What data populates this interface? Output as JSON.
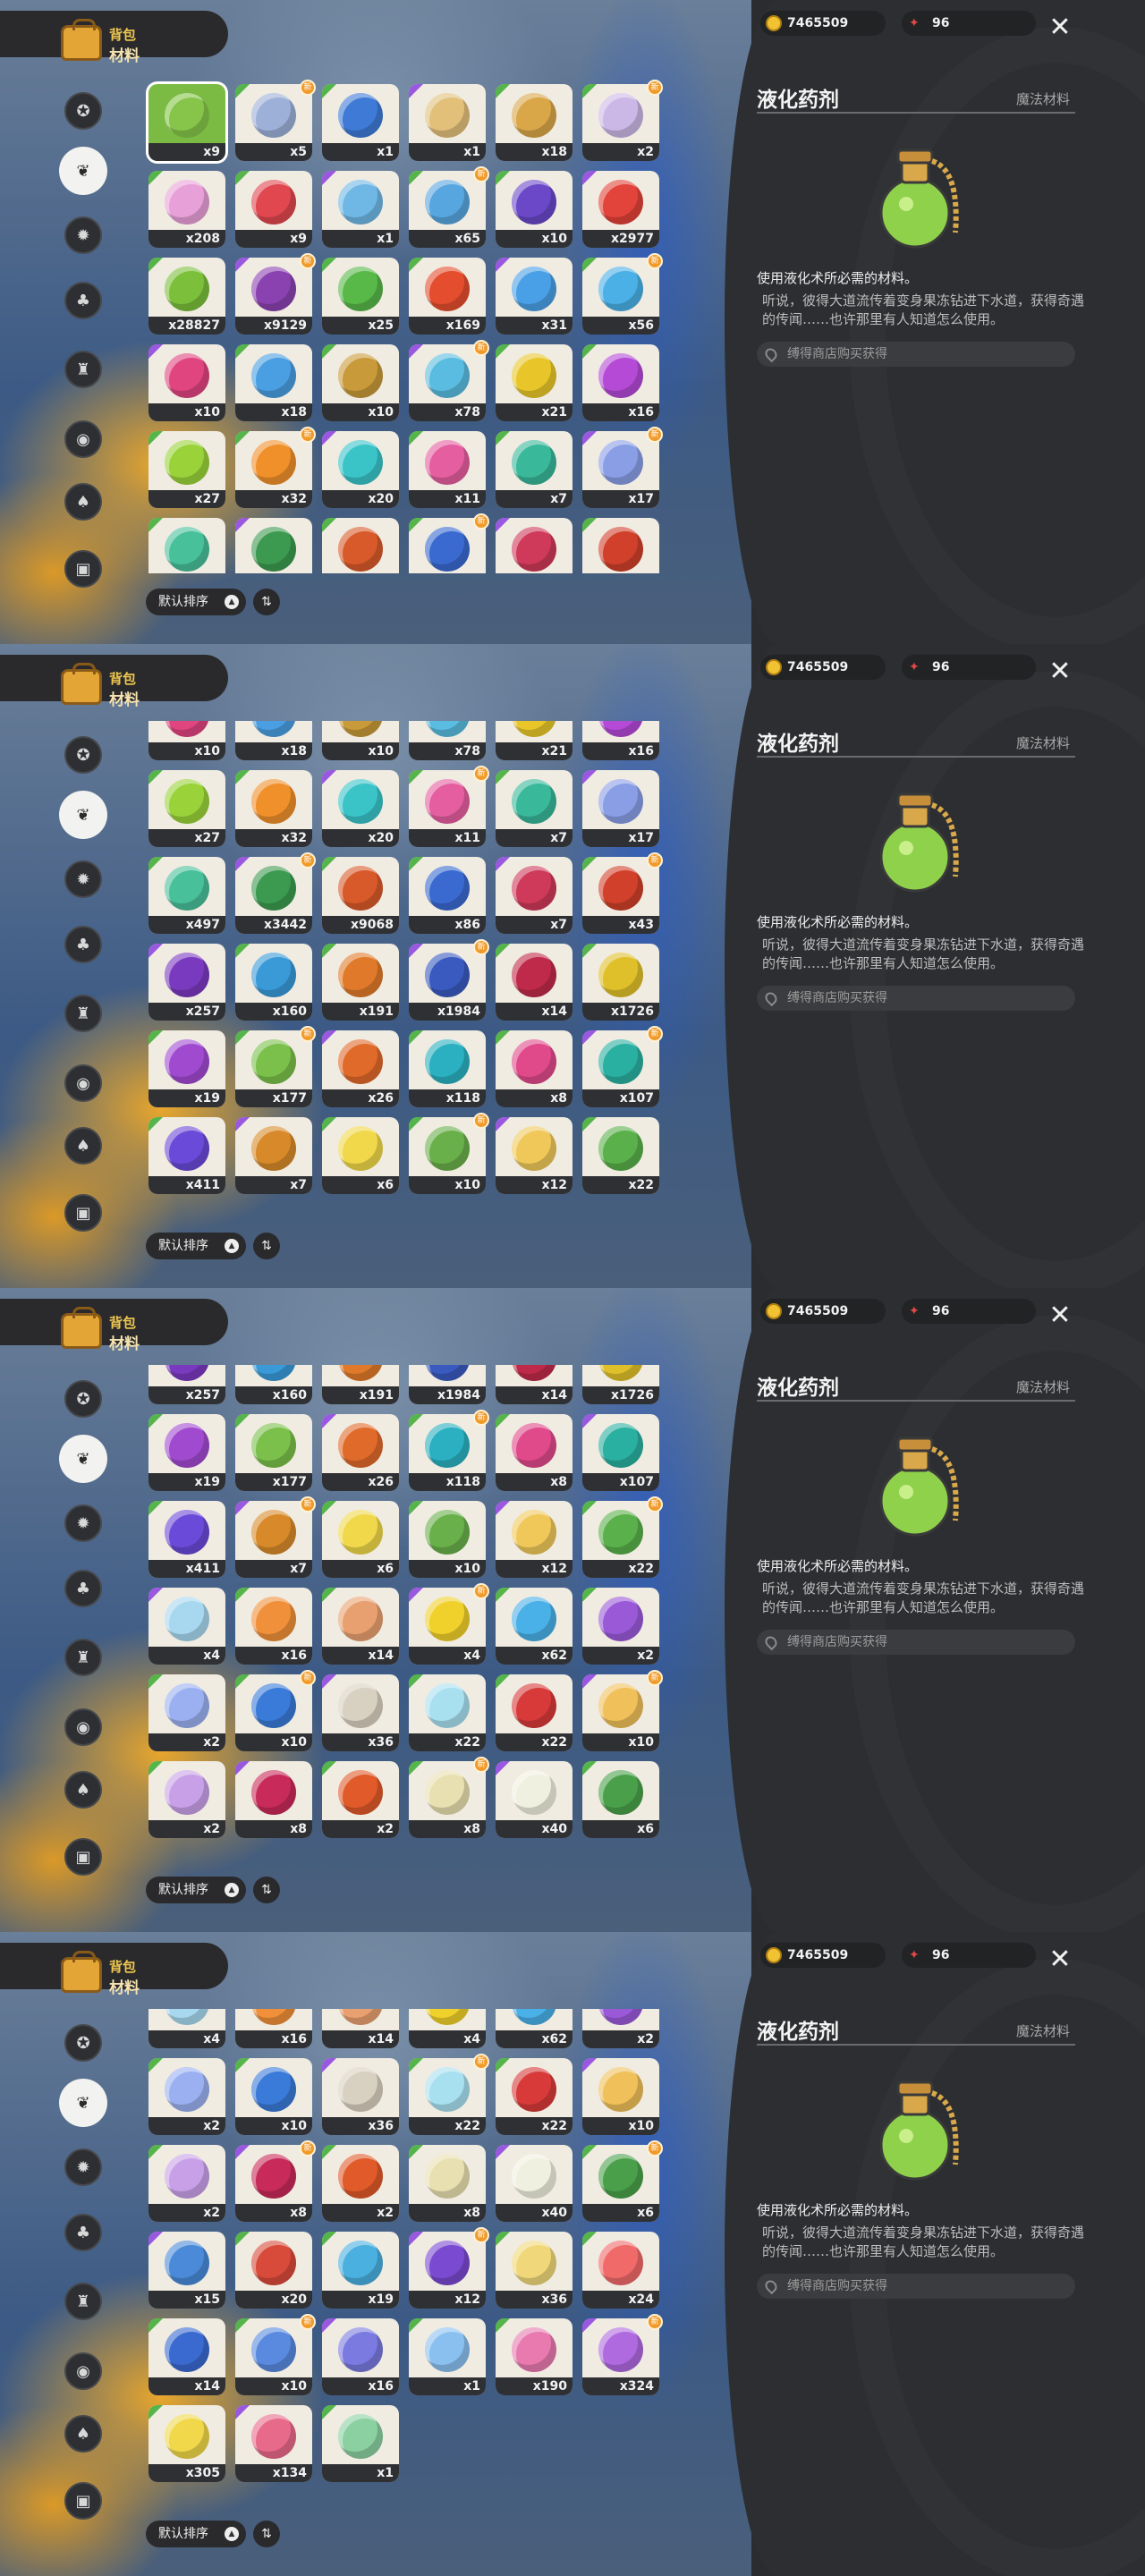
{
  "bag": {
    "label1": "背包",
    "label2": "材料"
  },
  "currency": {
    "coins": "7465509",
    "stars": "96"
  },
  "sort": {
    "label": "默认排序",
    "direction_icon": "▲",
    "toggle_icon": "⇅"
  },
  "detail": {
    "name": "液化药剂",
    "type": "魔法材料",
    "desc_main": "使用液化术所必需的材料。",
    "desc_story": "听说，彼得大道流传着变身果冻钻进下水道，获得奇遇的传闻……也许那里有人知道怎么使用。",
    "source": "缚得商店购买获得"
  },
  "sidebar_icons": [
    "star-badge-icon",
    "leaf-icon",
    "gear-icon",
    "sprout-icon",
    "cup-icon",
    "orb-icon",
    "acorn-icon",
    "chest-icon"
  ],
  "colors": {
    "accent_orange": "#f09a2a",
    "selected_green": "#7bbb44",
    "panel_dark": "#2c2e31"
  },
  "panels": [
    {
      "rows": [
        [
          {
            "c": "x9",
            "color": "#86c54a"
          },
          {
            "c": "x5",
            "color": "#9db0d8"
          },
          {
            "c": "x1",
            "color": "#3e7ad6"
          },
          {
            "c": "x1",
            "color": "#e2c07a"
          },
          {
            "c": "x18",
            "color": "#d9a648"
          },
          {
            "c": "x2",
            "color": "#cbb8e6"
          }
        ],
        [
          {
            "c": "x208",
            "color": "#e8a0d8"
          },
          {
            "c": "x9",
            "color": "#e0474f"
          },
          {
            "c": "x1",
            "color": "#6fb8e6"
          },
          {
            "c": "x65",
            "color": "#58a6e0"
          },
          {
            "c": "x10",
            "color": "#6a48c8"
          },
          {
            "c": "x2977",
            "color": "#e2433a"
          }
        ],
        [
          {
            "c": "x28827",
            "color": "#7bbf3a"
          },
          {
            "c": "x9129",
            "color": "#8a42b0"
          },
          {
            "c": "x25",
            "color": "#58b848"
          },
          {
            "c": "x169",
            "color": "#e44d2e"
          },
          {
            "c": "x31",
            "color": "#4aa0e6"
          },
          {
            "c": "x56",
            "color": "#4ab0e6"
          }
        ],
        [
          {
            "c": "x10",
            "color": "#e0457f"
          },
          {
            "c": "x18",
            "color": "#4a9fe2"
          },
          {
            "c": "x10",
            "color": "#c89a3a"
          },
          {
            "c": "x78",
            "color": "#5abce0"
          },
          {
            "c": "x21",
            "color": "#e8c62a"
          },
          {
            "c": "x16",
            "color": "#b44ad6"
          }
        ],
        [
          {
            "c": "x27",
            "color": "#9ad23a"
          },
          {
            "c": "x32",
            "color": "#f0902a"
          },
          {
            "c": "x20",
            "color": "#3ac4c8"
          },
          {
            "c": "x11",
            "color": "#e55fa0"
          },
          {
            "c": "x7",
            "color": "#3ab89a"
          },
          {
            "c": "x17",
            "color": "#8a9ee6"
          }
        ],
        [
          {
            "c": "x497",
            "color": "#48c09a"
          },
          {
            "c": "x3442",
            "color": "#3c9a50"
          },
          {
            "c": "x9068",
            "color": "#d85a2a"
          },
          {
            "c": "x86",
            "color": "#3a6ad0"
          },
          {
            "c": "x7",
            "color": "#cf3a5a"
          },
          {
            "c": "x43",
            "color": "#d0402a"
          }
        ]
      ]
    },
    {
      "rows": [
        [
          {
            "c": "x10",
            "color": "#e0457f"
          },
          {
            "c": "x18",
            "color": "#4a9fe2"
          },
          {
            "c": "x10",
            "color": "#c89a3a"
          },
          {
            "c": "x78",
            "color": "#5abce0"
          },
          {
            "c": "x21",
            "color": "#e8c62a"
          },
          {
            "c": "x16",
            "color": "#b44ad6"
          }
        ],
        [
          {
            "c": "x27",
            "color": "#9ad23a"
          },
          {
            "c": "x32",
            "color": "#f0902a"
          },
          {
            "c": "x20",
            "color": "#3ac4c8"
          },
          {
            "c": "x11",
            "color": "#e55fa0"
          },
          {
            "c": "x7",
            "color": "#3ab89a"
          },
          {
            "c": "x17",
            "color": "#8a9ee6"
          }
        ],
        [
          {
            "c": "x497",
            "color": "#48c09a"
          },
          {
            "c": "x3442",
            "color": "#3c9a50"
          },
          {
            "c": "x9068",
            "color": "#d85a2a"
          },
          {
            "c": "x86",
            "color": "#3a6ad0"
          },
          {
            "c": "x7",
            "color": "#cf3a5a"
          },
          {
            "c": "x43",
            "color": "#d0402a"
          }
        ],
        [
          {
            "c": "x257",
            "color": "#7a3ac0"
          },
          {
            "c": "x160",
            "color": "#3a9ad8"
          },
          {
            "c": "x191",
            "color": "#e07a2a"
          },
          {
            "c": "x1984",
            "color": "#3a5ac0"
          },
          {
            "c": "x14",
            "color": "#c02a4a"
          },
          {
            "c": "x1726",
            "color": "#e0c02a"
          }
        ],
        [
          {
            "c": "x19",
            "color": "#a04ad0"
          },
          {
            "c": "x177",
            "color": "#7ac04a"
          },
          {
            "c": "x26",
            "color": "#e06a2a"
          },
          {
            "c": "x118",
            "color": "#2ab0c0"
          },
          {
            "c": "x8",
            "color": "#e04a8a"
          },
          {
            "c": "x107",
            "color": "#2ab0a0"
          }
        ],
        [
          {
            "c": "x411",
            "color": "#6a4ad8"
          },
          {
            "c": "x7",
            "color": "#d88a2a"
          },
          {
            "c": "x6",
            "color": "#f0d84a"
          },
          {
            "c": "x10",
            "color": "#6ab04a"
          },
          {
            "c": "x12",
            "color": "#f0c85a"
          },
          {
            "c": "x22",
            "color": "#5ab04a"
          }
        ]
      ]
    },
    {
      "rows": [
        [
          {
            "c": "x257",
            "color": "#7a3ac0"
          },
          {
            "c": "x160",
            "color": "#3a9ad8"
          },
          {
            "c": "x191",
            "color": "#e07a2a"
          },
          {
            "c": "x1984",
            "color": "#3a5ac0"
          },
          {
            "c": "x14",
            "color": "#c02a4a"
          },
          {
            "c": "x1726",
            "color": "#e0c02a"
          }
        ],
        [
          {
            "c": "x19",
            "color": "#a04ad0"
          },
          {
            "c": "x177",
            "color": "#7ac04a"
          },
          {
            "c": "x26",
            "color": "#e06a2a"
          },
          {
            "c": "x118",
            "color": "#2ab0c0"
          },
          {
            "c": "x8",
            "color": "#e04a8a"
          },
          {
            "c": "x107",
            "color": "#2ab0a0"
          }
        ],
        [
          {
            "c": "x411",
            "color": "#6a4ad8"
          },
          {
            "c": "x7",
            "color": "#d88a2a"
          },
          {
            "c": "x6",
            "color": "#f0d84a"
          },
          {
            "c": "x10",
            "color": "#6ab04a"
          },
          {
            "c": "x12",
            "color": "#f0c85a"
          },
          {
            "c": "x22",
            "color": "#5ab04a"
          }
        ],
        [
          {
            "c": "x4",
            "color": "#a8d8f0"
          },
          {
            "c": "x16",
            "color": "#f0903a"
          },
          {
            "c": "x14",
            "color": "#e8a070"
          },
          {
            "c": "x4",
            "color": "#f0d02a"
          },
          {
            "c": "x62",
            "color": "#4ab0e8"
          },
          {
            "c": "x2",
            "color": "#9a5ad8"
          }
        ],
        [
          {
            "c": "x2",
            "color": "#9ab0f0"
          },
          {
            "c": "x10",
            "color": "#3a7ad8"
          },
          {
            "c": "x36",
            "color": "#d8d0c0"
          },
          {
            "c": "x22",
            "color": "#a8e0f0"
          },
          {
            "c": "x22",
            "color": "#d83a3a"
          },
          {
            "c": "x10",
            "color": "#f0c05a"
          }
        ],
        [
          {
            "c": "x2",
            "color": "#c8a0e8"
          },
          {
            "c": "x8",
            "color": "#c82a5a"
          },
          {
            "c": "x2",
            "color": "#e05a2a"
          },
          {
            "c": "x8",
            "color": "#e8e0b0"
          },
          {
            "c": "x40",
            "color": "#f0f0e0"
          },
          {
            "c": "x6",
            "color": "#4aa04a"
          }
        ]
      ]
    },
    {
      "rows": [
        [
          {
            "c": "x4",
            "color": "#a8d8f0"
          },
          {
            "c": "x16",
            "color": "#f0903a"
          },
          {
            "c": "x14",
            "color": "#e8a070"
          },
          {
            "c": "x4",
            "color": "#f0d02a"
          },
          {
            "c": "x62",
            "color": "#4ab0e8"
          },
          {
            "c": "x2",
            "color": "#9a5ad8"
          }
        ],
        [
          {
            "c": "x2",
            "color": "#9ab0f0"
          },
          {
            "c": "x10",
            "color": "#3a7ad8"
          },
          {
            "c": "x36",
            "color": "#d8d0c0"
          },
          {
            "c": "x22",
            "color": "#a8e0f0"
          },
          {
            "c": "x22",
            "color": "#d83a3a"
          },
          {
            "c": "x10",
            "color": "#f0c05a"
          }
        ],
        [
          {
            "c": "x2",
            "color": "#c8a0e8"
          },
          {
            "c": "x8",
            "color": "#c82a5a"
          },
          {
            "c": "x2",
            "color": "#e05a2a"
          },
          {
            "c": "x8",
            "color": "#e8e0b0"
          },
          {
            "c": "x40",
            "color": "#f0f0e0"
          },
          {
            "c": "x6",
            "color": "#4aa04a"
          }
        ],
        [
          {
            "c": "x15",
            "color": "#4a8ad8"
          },
          {
            "c": "x20",
            "color": "#d84a3a"
          },
          {
            "c": "x19",
            "color": "#4ab0e0"
          },
          {
            "c": "x12",
            "color": "#7a4ad0"
          },
          {
            "c": "x36",
            "color": "#f0d87a"
          },
          {
            "c": "x24",
            "color": "#f06a6a"
          }
        ],
        [
          {
            "c": "x14",
            "color": "#3a6ad0"
          },
          {
            "c": "x10",
            "color": "#5a8ae0"
          },
          {
            "c": "x16",
            "color": "#7a7ae0"
          },
          {
            "c": "x1",
            "color": "#8ac0f0"
          },
          {
            "c": "x190",
            "color": "#e87ab0"
          },
          {
            "c": "x324",
            "color": "#b06ae0"
          }
        ],
        [
          {
            "c": "x305",
            "color": "#f0d84a"
          },
          {
            "c": "x134",
            "color": "#e86a8a"
          },
          {
            "c": "x1",
            "color": "#8ad0a0"
          }
        ]
      ]
    }
  ]
}
